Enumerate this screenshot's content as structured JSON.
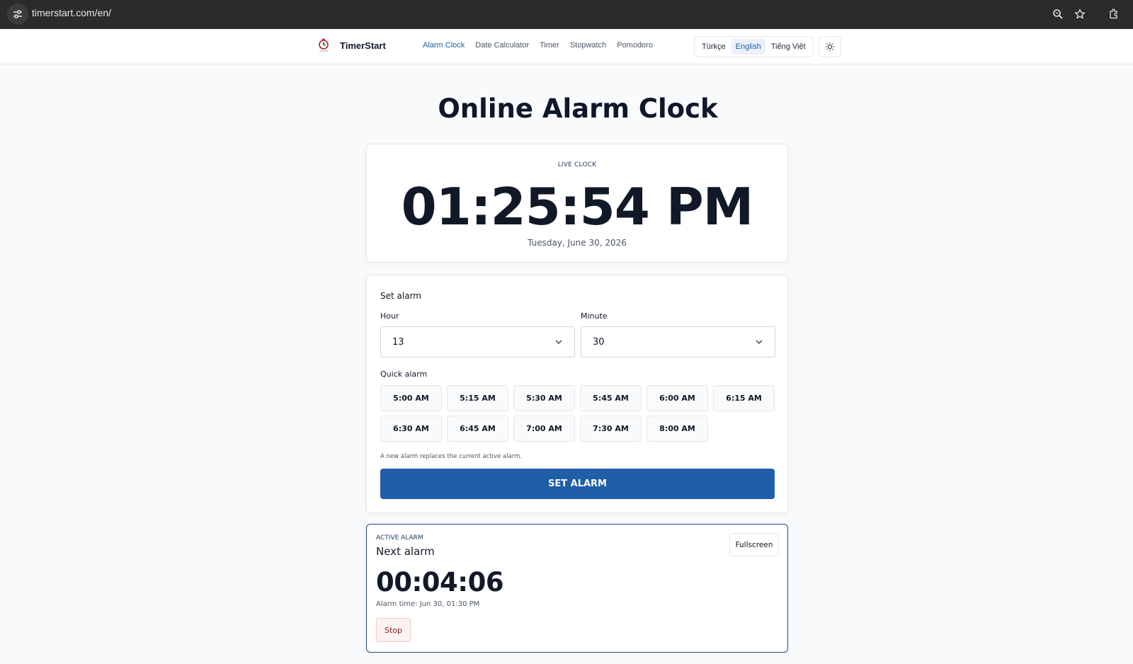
{
  "browser": {
    "url": "timerstart.com/en/",
    "icons": [
      "site-info-icon",
      "zoom-icon",
      "star-icon",
      "extensions-icon"
    ]
  },
  "header": {
    "logo_text": "TimerStart",
    "nav": [
      {
        "label": "Alarm Clock",
        "active": true
      },
      {
        "label": "Date Calculator",
        "active": false
      },
      {
        "label": "Timer",
        "active": false
      },
      {
        "label": "Stopwatch",
        "active": false
      },
      {
        "label": "Pomodoro",
        "active": false
      }
    ],
    "languages": [
      {
        "label": "Türkçe",
        "active": false
      },
      {
        "label": "English",
        "active": true
      },
      {
        "label": "Tiếng Việt",
        "active": false
      }
    ],
    "theme_icon": "sun-icon"
  },
  "page": {
    "title": "Online Alarm Clock"
  },
  "live_clock": {
    "label": "LIVE CLOCK",
    "time": "01:25:54 PM",
    "date": "Tuesday, June 30, 2026"
  },
  "set_alarm": {
    "title": "Set alarm",
    "hour_label": "Hour",
    "hour_value": "13",
    "minute_label": "Minute",
    "minute_value": "30",
    "quick_label": "Quick alarm",
    "quick_options": [
      "5:00 AM",
      "5:15 AM",
      "5:30 AM",
      "5:45 AM",
      "6:00 AM",
      "6:15 AM",
      "6:30 AM",
      "6:45 AM",
      "7:00 AM",
      "7:30 AM",
      "8:00 AM"
    ],
    "hint": "A new alarm replaces the current active alarm.",
    "button_label": "SET ALARM"
  },
  "active_alarm": {
    "label": "ACTIVE ALARM",
    "title": "Next alarm",
    "fullscreen_label": "Fullscreen",
    "countdown": "00:04:06",
    "alarm_time": "Alarm time: Jun 30, 01:30 PM",
    "stop_label": "Stop"
  },
  "colors": {
    "accent": "#1f5ea8",
    "nav_active": "#1e5fa0",
    "stop_bg": "#fdf2f2"
  }
}
